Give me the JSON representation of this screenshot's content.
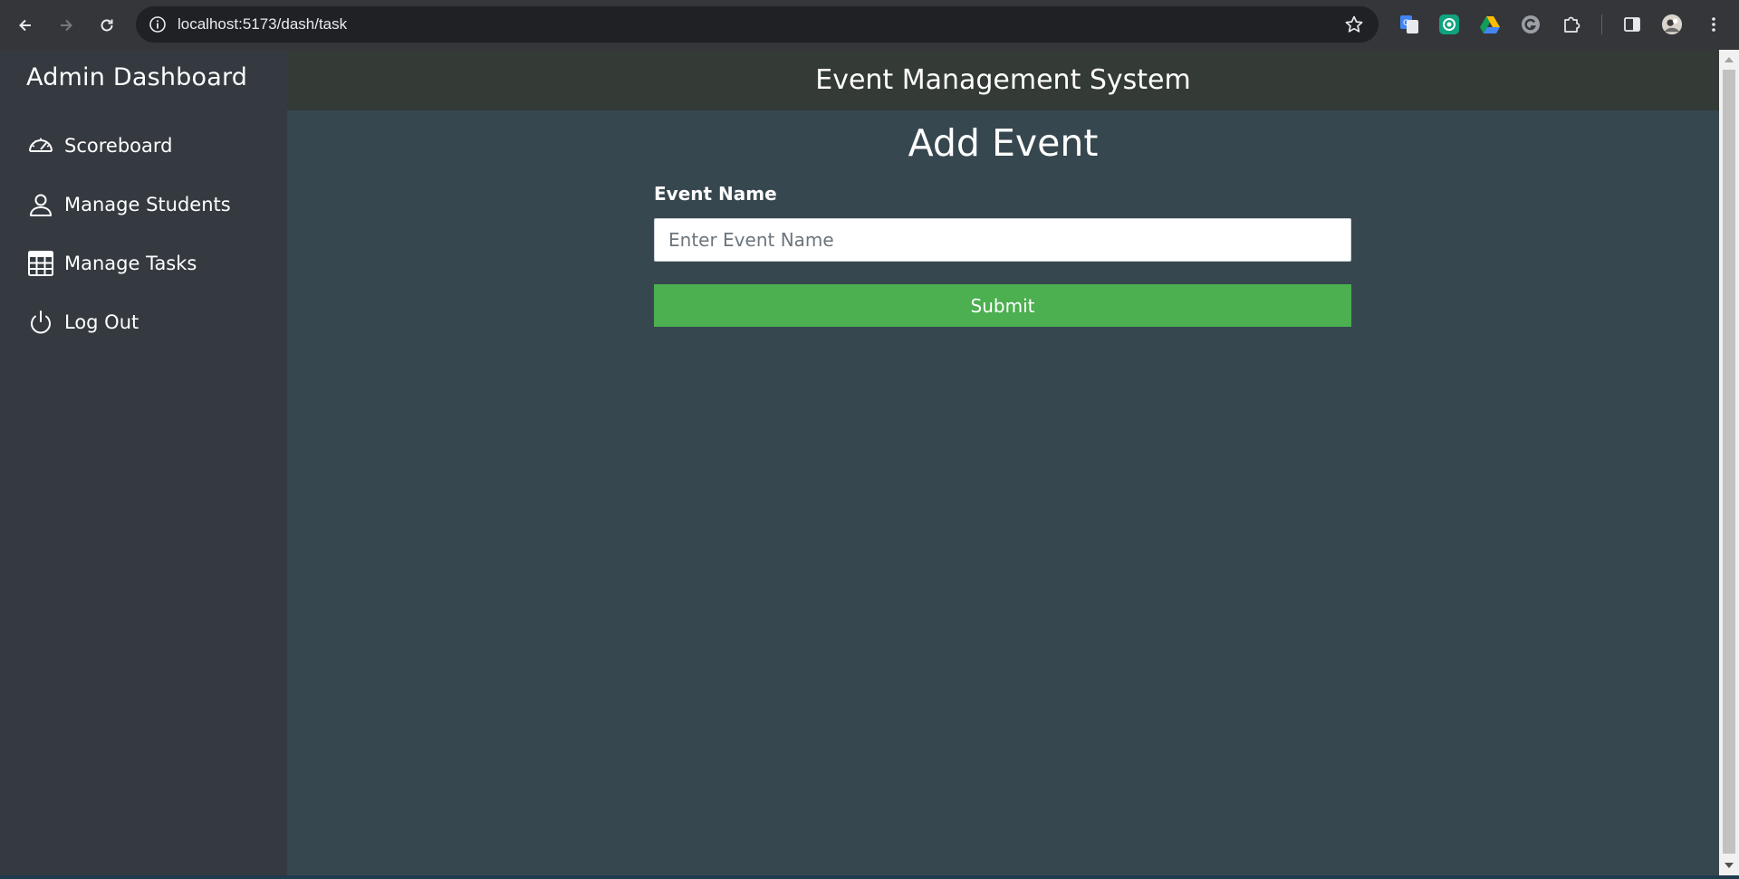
{
  "browser": {
    "url": "localhost:5173/dash/task"
  },
  "sidebar": {
    "title": "Admin Dashboard",
    "items": [
      {
        "label": "Scoreboard",
        "icon": "speedometer-icon"
      },
      {
        "label": "Manage Students",
        "icon": "person-icon"
      },
      {
        "label": "Manage Tasks",
        "icon": "table-icon"
      },
      {
        "label": "Log Out",
        "icon": "power-icon"
      }
    ]
  },
  "header": {
    "title": "Event Management System"
  },
  "main": {
    "page_title": "Add Event",
    "field_label": "Event Name",
    "input_placeholder": "Enter Event Name",
    "input_value": "",
    "submit_label": "Submit"
  },
  "colors": {
    "sidebar_bg": "#343a40",
    "topbar_bg": "#343a36",
    "main_bg": "#37474f",
    "submit_bg": "#4caf50"
  }
}
